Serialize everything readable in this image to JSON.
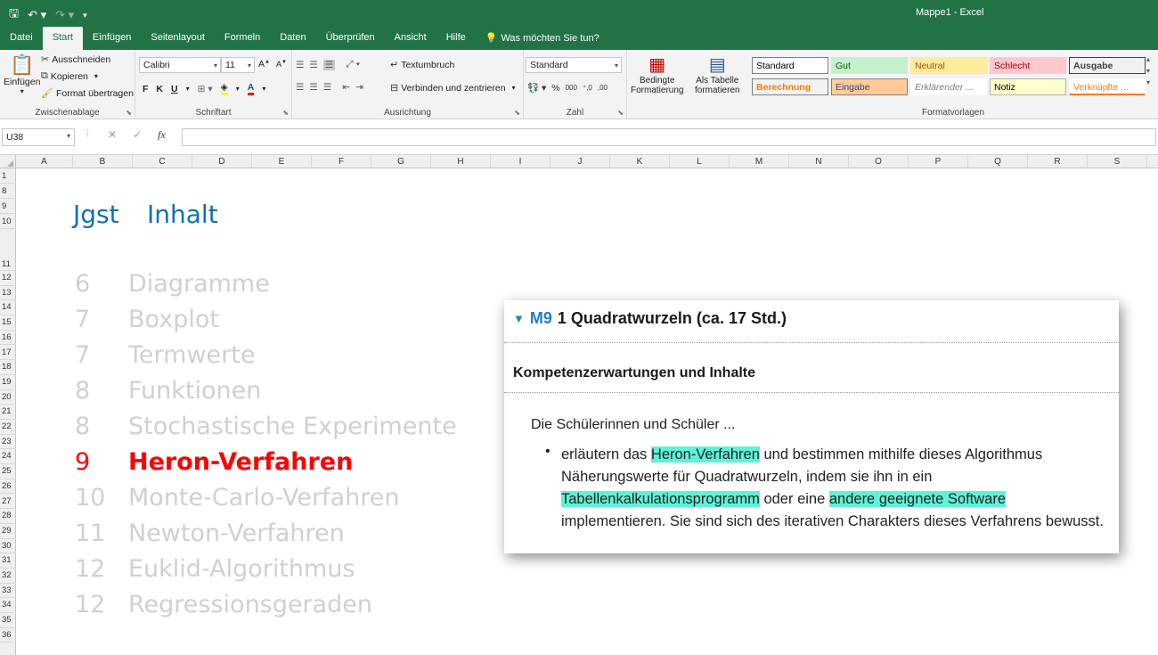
{
  "window": {
    "title": "Mappe1 - Excel",
    "qat_icons": [
      "save-icon",
      "undo-icon",
      "redo-icon",
      "customize-icon"
    ]
  },
  "tabs": [
    "Datei",
    "Start",
    "Einfügen",
    "Seitenlayout",
    "Formeln",
    "Daten",
    "Überprüfen",
    "Ansicht",
    "Hilfe"
  ],
  "active_tab": "Start",
  "tell_me": "Was möchten Sie tun?",
  "ribbon": {
    "clipboard": {
      "paste": "Einfügen",
      "cut": "Ausschneiden",
      "copy": "Kopieren",
      "format_painter": "Format übertragen",
      "label": "Zwischenablage"
    },
    "font": {
      "name": "Calibri",
      "size": "11",
      "bold": "F",
      "italic": "K",
      "underline": "U",
      "label": "Schriftart"
    },
    "alignment": {
      "wrap": "Textumbruch",
      "merge": "Verbinden und zentrieren",
      "label": "Ausrichtung"
    },
    "number": {
      "format": "Standard",
      "label": "Zahl"
    },
    "conditional": {
      "cond_fmt_1": "Bedingte",
      "cond_fmt_2": "Formatierung",
      "as_table_1": "Als Tabelle",
      "as_table_2": "formatieren"
    },
    "styles": {
      "label": "Formatvorlagen",
      "items": [
        {
          "label": "Standard",
          "bg": "#ffffff",
          "color": "#000000",
          "border": "#7f7f7f"
        },
        {
          "label": "Gut",
          "bg": "#c6efce",
          "color": "#006100",
          "border": "#c6efce"
        },
        {
          "label": "Neutral",
          "bg": "#ffeb9c",
          "color": "#9c5700",
          "border": "#ffeb9c"
        },
        {
          "label": "Schlecht",
          "bg": "#ffc7ce",
          "color": "#9c0006",
          "border": "#ffc7ce"
        },
        {
          "label": "Ausgabe",
          "bg": "#f2f2f2",
          "color": "#3f3f3f",
          "border": "#3f3f3f"
        },
        {
          "label": "Berechnung",
          "bg": "#f2f2f2",
          "color": "#fa7d00",
          "border": "#7f7f7f"
        },
        {
          "label": "Eingabe",
          "bg": "#ffcc99",
          "color": "#3f3f76",
          "border": "#7f7f7f"
        },
        {
          "label": "Erklärender ...",
          "bg": "#ffffff",
          "color": "#7f7f7f",
          "border": "#ffffff"
        },
        {
          "label": "Notiz",
          "bg": "#ffffcc",
          "color": "#000000",
          "border": "#b2b2b2"
        },
        {
          "label": "Verknüpfte ...",
          "bg": "#ffffff",
          "color": "#fa7d00",
          "border": "#ffffff"
        }
      ]
    }
  },
  "formula_bar": {
    "name_box": "U38",
    "fx": "fx",
    "formula": ""
  },
  "columns": [
    "A",
    "B",
    "C",
    "D",
    "E",
    "F",
    "G",
    "H",
    "I",
    "J",
    "K",
    "L",
    "M",
    "N",
    "O",
    "P",
    "Q",
    "R",
    "S"
  ],
  "rows": [
    "1",
    "8",
    "9",
    "10",
    "11",
    "12",
    "13",
    "14",
    "15",
    "16",
    "17",
    "18",
    "19",
    "20",
    "21",
    "22",
    "23",
    "24",
    "25",
    "26",
    "27",
    "28",
    "29",
    "30",
    "31",
    "32",
    "33",
    "34",
    "35",
    "36"
  ],
  "slide": {
    "col_jgst": "Jgst",
    "col_inhalt": "Inhalt",
    "topics": [
      {
        "grade": "6",
        "topic": "Diagramme"
      },
      {
        "grade": "7",
        "topic": "Boxplot"
      },
      {
        "grade": "7",
        "topic": "Termwerte"
      },
      {
        "grade": "8",
        "topic": "Funktionen"
      },
      {
        "grade": "8",
        "topic": "Stochastische Experimente"
      },
      {
        "grade": "9",
        "topic": "Heron-Verfahren",
        "highlight": true
      },
      {
        "grade": "10",
        "topic": "Monte-Carlo-Verfahren"
      },
      {
        "grade": "11",
        "topic": "Newton-Verfahren"
      },
      {
        "grade": "12",
        "topic": "Euklid-Algorithmus"
      },
      {
        "grade": "12",
        "topic": "Regressionsgeraden"
      }
    ],
    "muted_color": "#d0d0d0",
    "highlight_color": "#ff0000",
    "header_color": "#0e6fb7"
  },
  "card": {
    "code": "M9",
    "title": "1  Quadratwurzeln (ca. 17 Std.)",
    "subtitle": "Kompetenzerwartungen und Inhalte",
    "intro": "Die Schülerinnen und Schüler ...",
    "bullet": "•",
    "text_1": "erläutern das ",
    "mark_1": "Heron-Verfahren",
    "text_2": " und bestimmen mithilfe dieses Algorithmus Näherungswerte für Quadratwurzeln, indem sie ihn in ein ",
    "mark_2": "Tabellenkalkulationsprogramm",
    "text_3": " oder eine ",
    "mark_3": "andere geeignete Software ",
    "text_4": " implementieren. Sie sind sich des iterativen Charakters dieses Verfahrens bewusst.",
    "accent": "#1f7fc0",
    "mark_color": "#5ff2d8"
  }
}
